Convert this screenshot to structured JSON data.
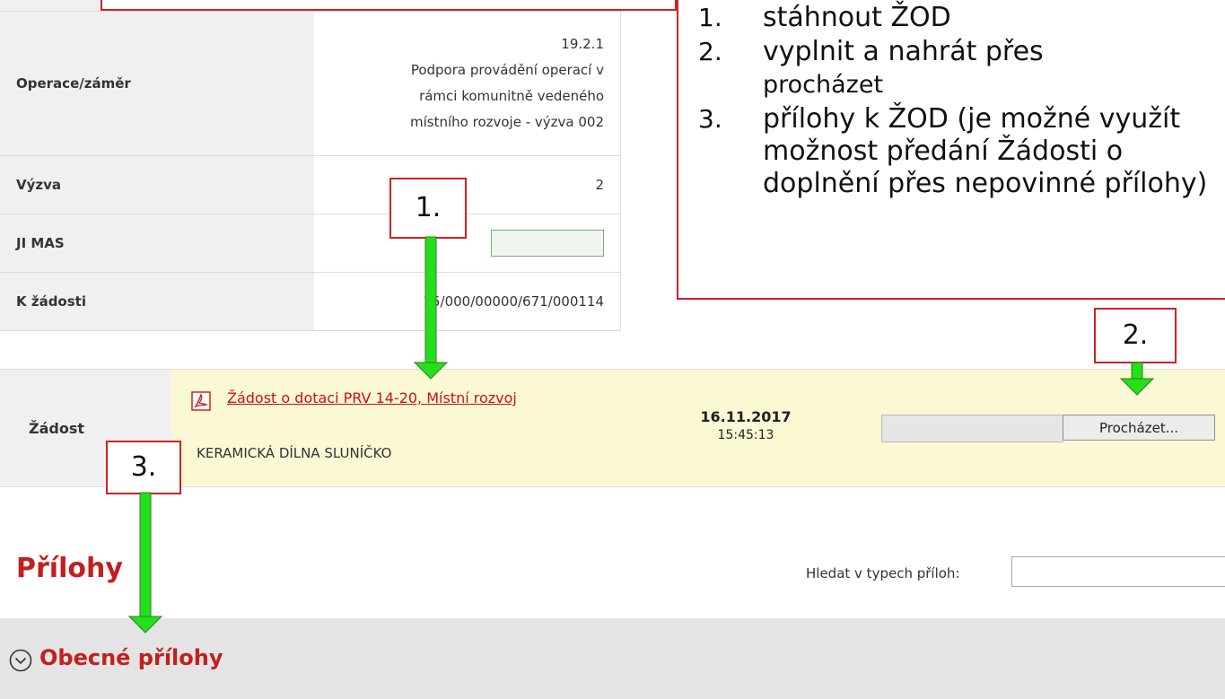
{
  "project": {
    "rows": [
      {
        "label": "Operace/záměr",
        "lines": [
          "19.2.1",
          "Podpora provádění operací v",
          "rámci komunitně vedeného",
          "místního rozvoje - výzva 002"
        ]
      },
      {
        "label": "Výzva",
        "value": "2"
      },
      {
        "label": "JI MAS",
        "value": ""
      },
      {
        "label": "K žádosti",
        "value": "15/000/00000/671/000114"
      }
    ]
  },
  "zadost": {
    "label": "Žádost",
    "document_link": "Žádost o dotaci PRV 14-20, Místní rozvoj",
    "applicant": "KERAMICKÁ DÍLNA SLUNÍČKO",
    "date": "16.11.2017",
    "time": "15:45:13",
    "browse_button": "Procházet...",
    "file_path_value": ""
  },
  "prilohy": {
    "title": "Přílohy",
    "search_label": "Hledat v typech příloh:",
    "search_value": "",
    "section_title": "Obecné přílohy"
  },
  "instructions": {
    "items": [
      {
        "num": "1.",
        "text": "stáhnout ŽOD"
      },
      {
        "num": "2.",
        "text": "vyplnit a nahrát přes",
        "sub": "procházet"
      },
      {
        "num": "3.",
        "text": "přílohy k ŽOD (je možné využít možnost předání Žádosti o doplnění přes nepovinné přílohy)"
      }
    ]
  },
  "step_labels": [
    "1.",
    "2.",
    "3."
  ],
  "colors": {
    "annotation_red": "#d32121",
    "arrow_green": "#22e01a",
    "highlight_yellow": "#fbf9d4",
    "link_red": "#cc1111"
  }
}
